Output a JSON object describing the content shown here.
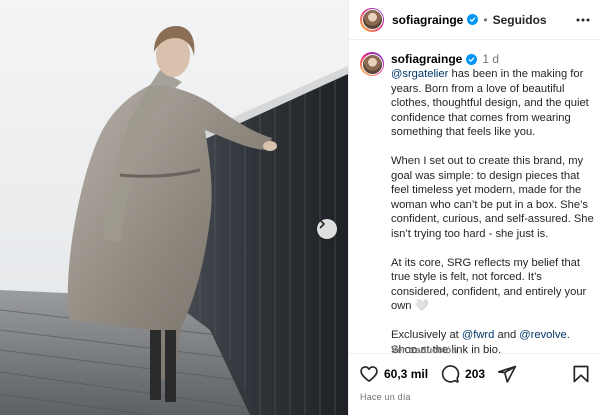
{
  "post": {
    "username": "sofiagrainge",
    "follow_status": "Seguidos",
    "separator": "•",
    "time": "1 d",
    "caption": {
      "p1_mention": "@srgatelier",
      "p1_text": " has been in the making for years. Born from a love of beautiful clothes, thoughtful design, and the quiet confidence that comes from wearing something that feels like you.",
      "p2_text": "When I set out to create this brand, my goal was simple: to design pieces that feel timeless yet modern, made for the woman who can’t be put in a box. She’s confident, curious, and self-assured. She isn’t trying too hard - she just is.",
      "p3_text": "At its core, SRG reflects my belief that true style is felt, not forced. It’s considered, confident, and entirely your own",
      "p3_heart": "🤍",
      "p4_prefix": "Exclusively at ",
      "p4_mention1": "@fwrd",
      "p4_and": " and ",
      "p4_mention2": "@revolve",
      "p4_suffix": ".",
      "p4_line2": "Shop at the link in bio."
    },
    "see_translation": "Ver traducción",
    "likes": "60,3 mil",
    "comments": "203",
    "time_ago": "Hace un día"
  },
  "icons": {
    "verified": "verified-badge-icon",
    "more": "more-options-icon",
    "like": "heart-icon",
    "comment": "comment-icon",
    "share": "share-icon",
    "save": "bookmark-icon",
    "next": "chevron-right-icon"
  },
  "colors": {
    "verified_blue": "#0095f6",
    "mention": "#00376b",
    "muted": "#737373",
    "border": "#efefef"
  }
}
